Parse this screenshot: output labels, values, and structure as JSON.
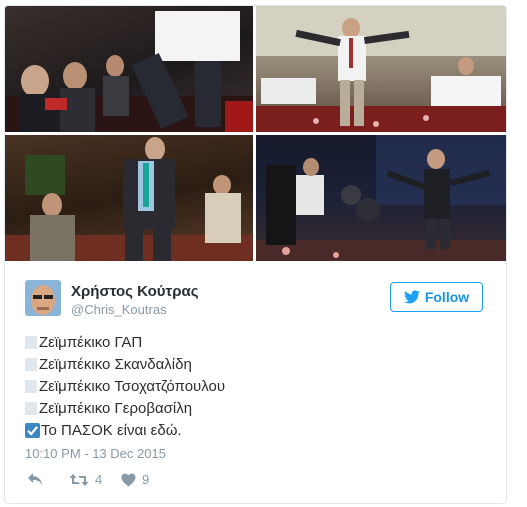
{
  "tweet": {
    "author_name": "Χρήστος Κούτρας",
    "author_handle": "@Chris_Koutras",
    "follow_label": "Follow",
    "lines": [
      {
        "checked": false,
        "text": "Ζεϊμπέκικο ΓΑΠ"
      },
      {
        "checked": false,
        "text": "Ζεϊμπέκικο Σκανδαλίδη"
      },
      {
        "checked": false,
        "text": "Ζεϊμπέκικο Τσοχατζόπουλου"
      },
      {
        "checked": false,
        "text": "Ζεϊμπέκικο Γεροβασίλη"
      },
      {
        "checked": true,
        "text": "Το ΠΑΣΟΚ είναι εδώ."
      }
    ],
    "timestamp": "10:10 PM - 13 Dec 2015",
    "retweet_count": "4",
    "like_count": "9"
  },
  "icons": {
    "follow": "twitter-bird-icon",
    "reply": "reply-icon",
    "retweet": "retweet-icon",
    "like": "heart-icon",
    "checked": "check-box-icon",
    "unchecked": "empty-box-icon"
  },
  "colors": {
    "accent": "#1da1f2",
    "text": "#292f33",
    "muted": "#8899a6",
    "border": "#e1e8ed",
    "check": "#3b88c3"
  }
}
